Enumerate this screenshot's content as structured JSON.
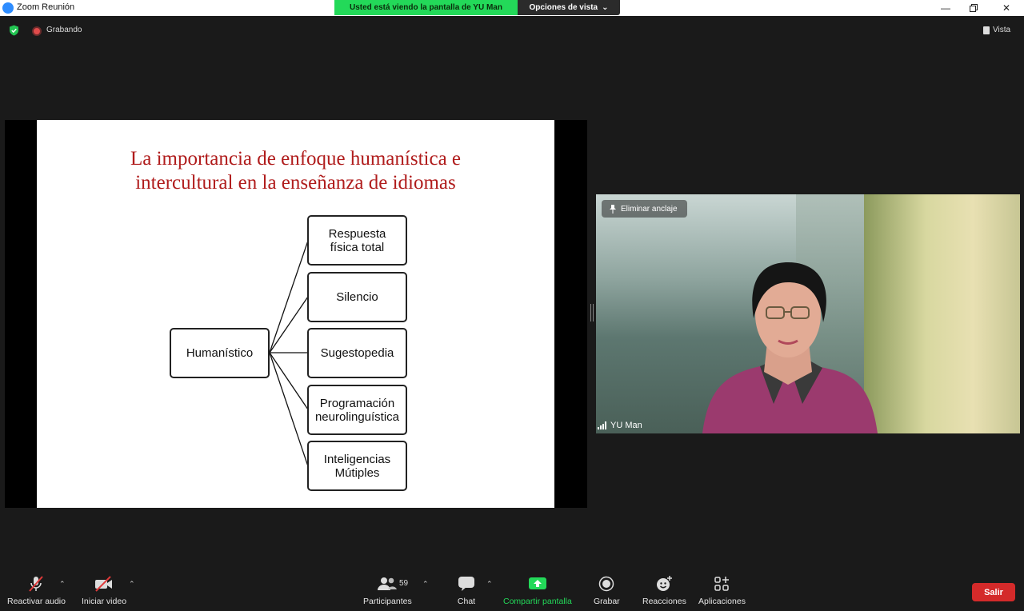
{
  "window": {
    "title": "Zoom Reunión",
    "viewing_banner": "Usted está viendo la pantalla de YU Man",
    "view_options": "Opciones de vista"
  },
  "topbar": {
    "recording_label": "Grabando",
    "view_button": "Vista"
  },
  "slide": {
    "title_line1": "La importancia de enfoque humanística e",
    "title_line2": "intercultural en la enseñanza de idiomas",
    "root_node": "Humanístico",
    "branches": [
      [
        "Respuesta",
        "física total"
      ],
      [
        "Silencio"
      ],
      [
        "Sugestopedia"
      ],
      [
        "Programación",
        "neurolinguística"
      ],
      [
        "Inteligencias",
        "Mútiples"
      ]
    ]
  },
  "video": {
    "unpin_label": "Eliminar anclaje",
    "participant_name": "YU Man"
  },
  "toolbar": {
    "unmute_label": "Reactivar audio",
    "start_video_label": "Iniciar video",
    "participants_label": "Participantes",
    "participants_count": "59",
    "chat_label": "Chat",
    "share_label": "Compartir pantalla",
    "record_label": "Grabar",
    "reactions_label": "Reacciones",
    "apps_label": "Aplicaciones",
    "leave_label": "Salir"
  },
  "colors": {
    "slide_title": "#b01c1c",
    "share_green": "#23d959",
    "leave_red": "#d42a2a"
  }
}
